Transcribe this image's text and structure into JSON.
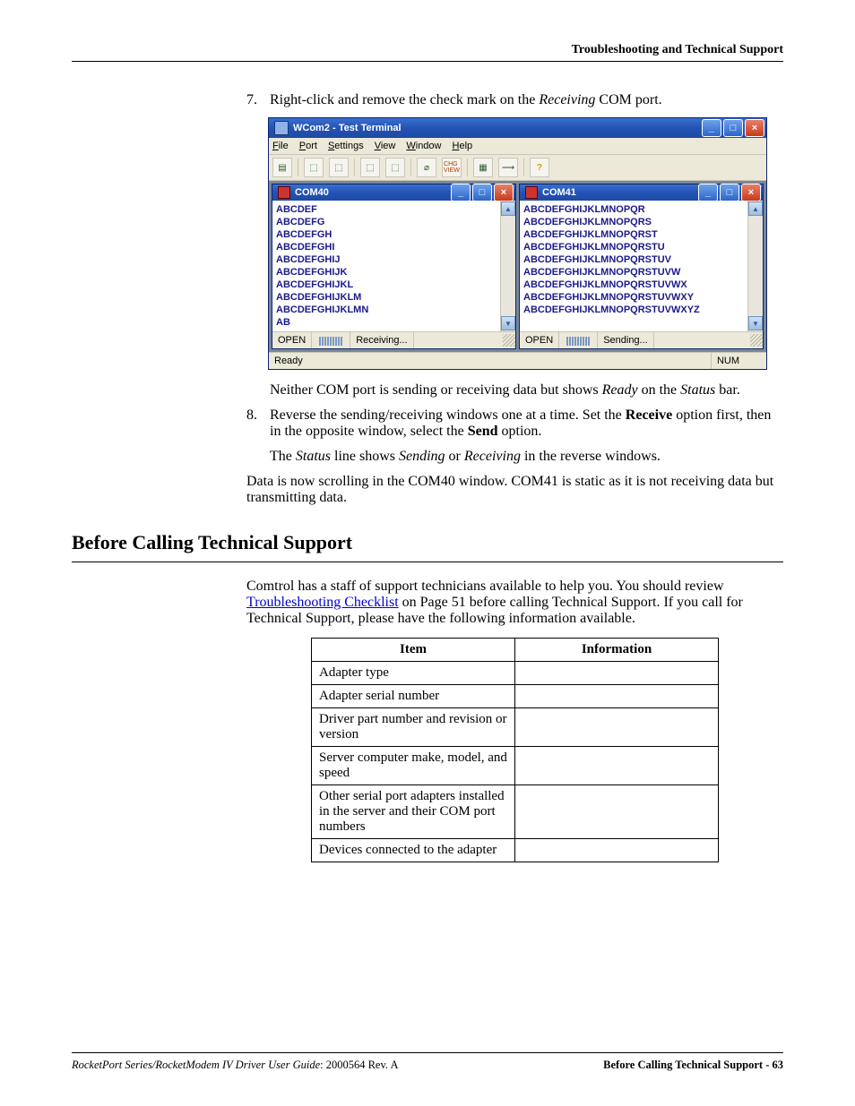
{
  "runhead": "Troubleshooting and Technical Support",
  "steps": {
    "s7num": "7.",
    "s7": "Right-click and remove the check mark on the ",
    "s7i": "Receiving",
    "s7b": " COM port.",
    "s8num": "8.",
    "s8a": "Reverse the sending/receiving windows one at a time. Set the ",
    "s8b": "Receive",
    "s8c": " option first, then in the opposite window, select the ",
    "s8d": "Send",
    "s8e": " option."
  },
  "after7a": "Neither COM port is sending or receiving data but shows ",
  "after7b": "Ready",
  "after7c": " on the ",
  "after7d": "Status",
  "after7e": " bar.",
  "after8a": "The ",
  "after8b": "Status",
  "after8c": " line shows ",
  "after8d": "Sending",
  "after8e": " or ",
  "after8f": "Receiving",
  "after8g": " in the reverse windows.",
  "closing": "Data is now scrolling in the COM40 window. COM41 is static as it is not receiving data but transmitting data.",
  "h2": "Before Calling Technical Support",
  "tsIntroA": "Comtrol has a staff of support technicians available to help you. You should review ",
  "tsLink": "Troubleshooting Checklist",
  "tsIntroB": " on Page 51 before calling Technical Support. If you call for Technical Support, please have the following information available.",
  "table": {
    "h1": "Item",
    "h2": "Information",
    "rows": [
      "Adapter type",
      "Adapter serial number",
      "Driver part number and revision or version",
      "Server computer make, model, and speed",
      "Other serial port adapters installed in the server and their COM port numbers",
      "Devices connected to the adapter"
    ]
  },
  "win": {
    "title": "WCom2 - Test Terminal",
    "menus": [
      "File",
      "Port",
      "Settings",
      "View",
      "Window",
      "Help"
    ],
    "toolbarIcons": [
      "doc-icon",
      "ports-in-icon",
      "ports-out-icon",
      "ports-in2-icon",
      "ports-out2-icon",
      "clear-icon",
      "chg-view-icon",
      "leds-icon",
      "raw-icon",
      "help-icon"
    ],
    "child": [
      {
        "title": "COM40",
        "lines": "ABCDEF\nABCDEFG\nABCDEFGH\nABCDEFGHI\nABCDEFGHIJ\nABCDEFGHIJK\nABCDEFGHIJKL\nABCDEFGHIJKLM\nABCDEFGHIJKLMN\nAB",
        "stat1": "OPEN",
        "stat2": "Receiving..."
      },
      {
        "title": "COM41",
        "lines": "ABCDEFGHIJKLMNOPQR\nABCDEFGHIJKLMNOPQRS\nABCDEFGHIJKLMNOPQRST\nABCDEFGHIJKLMNOPQRSTU\nABCDEFGHIJKLMNOPQRSTUV\nABCDEFGHIJKLMNOPQRSTUVW\nABCDEFGHIJKLMNOPQRSTUVWX\nABCDEFGHIJKLMNOPQRSTUVWXY\nABCDEFGHIJKLMNOPQRSTUVWXYZ",
        "stat1": "OPEN",
        "stat2": "Sending..."
      }
    ],
    "statusL": "Ready",
    "statusR": "NUM"
  },
  "footer": {
    "leftI": "RocketPort Series/RocketModem IV Driver User Guide",
    "leftN": ": 2000564 Rev. A",
    "right": "Before Calling Technical Support - 63"
  }
}
